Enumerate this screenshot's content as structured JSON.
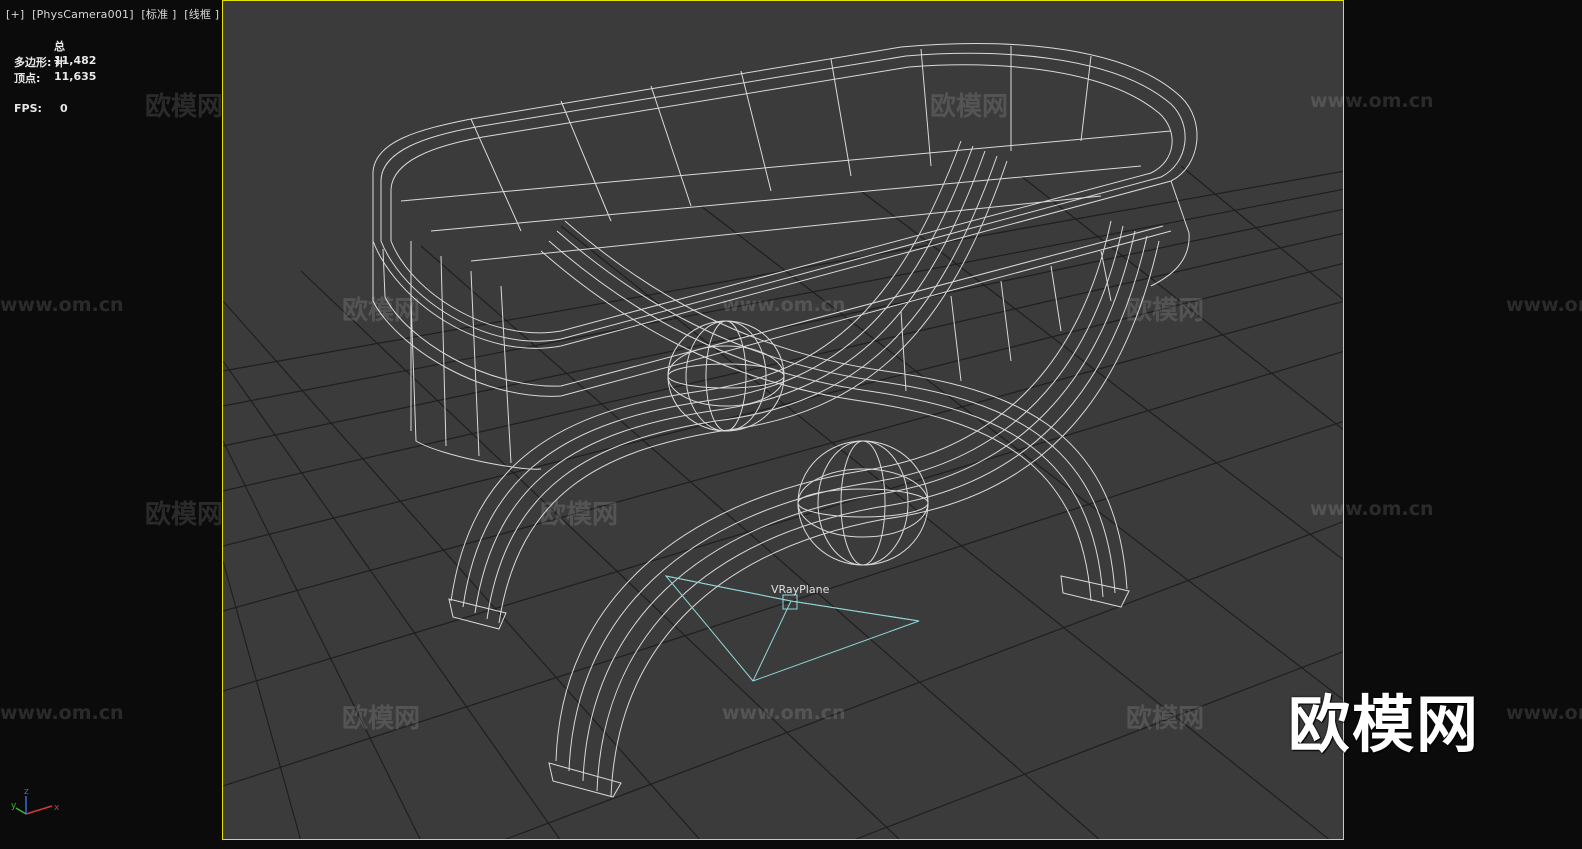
{
  "viewport": {
    "label_parts": [
      "[+]",
      "[PhysCamera001]",
      "[标准 ]",
      "[线框 ]"
    ],
    "frame_color": "#e6e000",
    "background_color": "#3b3b3b"
  },
  "stats": {
    "header": "总计",
    "polygons_label": "多边形:",
    "polygons_value": "11,482",
    "vertices_label": "顶点:",
    "vertices_value": "11,635",
    "fps_label": "FPS:",
    "fps_value": "0"
  },
  "scene": {
    "object_label": "VRayPlane",
    "wire_color": "#d9d9d9",
    "helper_color": "#8fd6d6"
  },
  "gizmo": {
    "x": "x",
    "y": "y",
    "z": "z"
  },
  "watermarks": {
    "brand": "欧模网",
    "url": "www.om.cn"
  },
  "logo_text": "欧模网"
}
